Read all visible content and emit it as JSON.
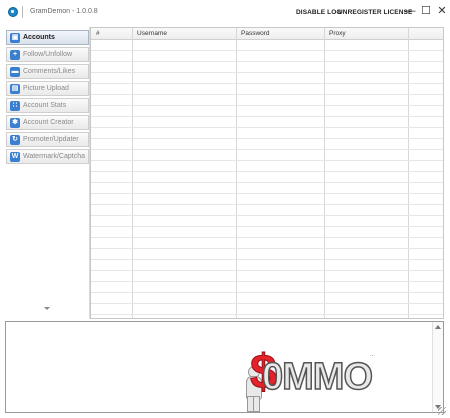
{
  "window": {
    "title": "GramDemon - 1.0.0.8",
    "links": {
      "disable_log": "DISABLE LOG",
      "unregister_license": "UNREGISTER LICENSE"
    },
    "controls": {
      "minimize": "—",
      "maximize": "☐",
      "close": "✕"
    }
  },
  "sidebar": {
    "items": [
      {
        "label": "Accounts",
        "icon": "person-card-icon",
        "glyph": "▣",
        "active": true
      },
      {
        "label": "Follow/Unfollow",
        "icon": "plus-icon",
        "glyph": "+"
      },
      {
        "label": "Comments/Likes",
        "icon": "comment-icon",
        "glyph": "▬"
      },
      {
        "label": "Picture Upload",
        "icon": "picture-icon",
        "glyph": "▤"
      },
      {
        "label": "Account Stats",
        "icon": "stats-icon",
        "glyph": "∷"
      },
      {
        "label": "Account Creator",
        "icon": "gear-icon",
        "glyph": "✱"
      },
      {
        "label": "Promoter/Updater",
        "icon": "refresh-icon",
        "glyph": "↻"
      },
      {
        "label": "Watermark/Captcha",
        "icon": "watermark-icon",
        "glyph": "W"
      }
    ]
  },
  "grid": {
    "columns": [
      "#",
      "Username",
      "Password",
      "Proxy"
    ],
    "rows": []
  },
  "log": {
    "text": "..."
  },
  "watermark": {
    "dollar": "$",
    "text": "0MMO"
  },
  "colors": {
    "accent": "#3b7fd0",
    "watermark_red": "#e4222b"
  }
}
